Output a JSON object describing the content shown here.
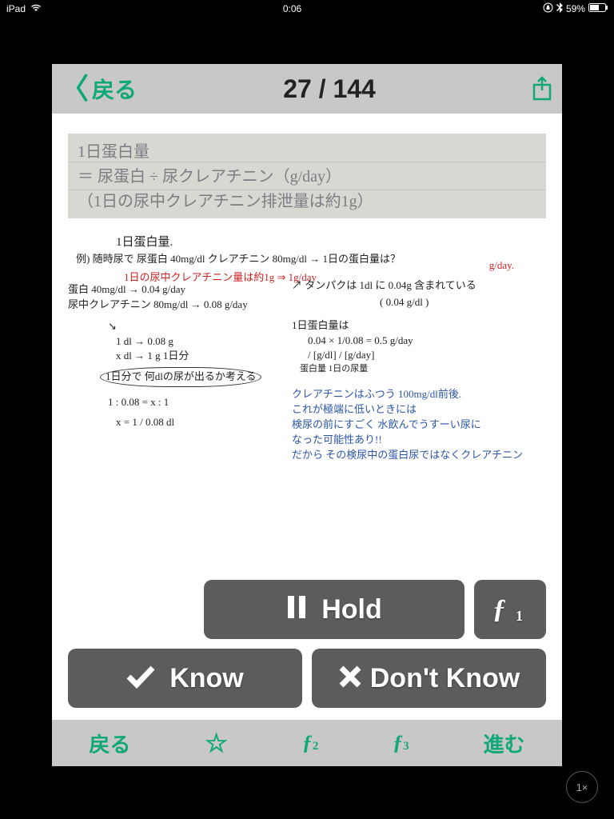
{
  "status_bar": {
    "device": "iPad",
    "time": "0:06",
    "battery_text": "59%"
  },
  "header": {
    "back_label": "戻る",
    "counter": "27 / 144"
  },
  "card": {
    "top_line1": "1日蛋白量",
    "top_line2": "＝ 尿蛋白 ÷ 尿クレアチニン（g/day）",
    "top_line3": "（1日の尿中クレアチニン排泄量は約1g）",
    "title": "1日蛋白量.",
    "example_label": "例)",
    "example": "随時尿で 尿蛋白 40mg/dl クレアチニン 80mg/dl → 1日の蛋白量は？",
    "red1": "1日の尿中クレアチニン量は約1g ⇒ 1g/day",
    "red2": "g/day.",
    "left1": "蛋白  40mg/dl → 0.04 g/day",
    "left2": "尿中クレアチニン 80mg/dl → 0.08 g/day",
    "left3": "1 dl → 0.08 g",
    "left4": "x dl → 1 g      1日分",
    "left5": "1日分で 何dlの尿が出るか考える",
    "left6": "1 : 0.08 = x : 1",
    "left7": "x = 1 / 0.08  dl",
    "right0": "タンパクは 1dl に 0.04g 含まれている",
    "right0b": "( 0.04 g/dl )",
    "right1": "1日蛋白量は",
    "right2": "0.04 × 1/0.08 = 0.5 g/day",
    "right3": "/ [g/dl]   / [g/day]",
    "right4": "蛋白量    1日の尿量",
    "blue1": "クレアチニンはふつう 100mg/dl前後.",
    "blue2": "これが極端に低いときには",
    "blue3": "検尿の前にすごく 水飲んでうすーい尿に",
    "blue4": "なった可能性あり!!",
    "blue5": "だから その検尿中の蛋白尿ではなくクレアチニン"
  },
  "buttons": {
    "hold": "Hold",
    "f1": "ƒ",
    "f1_sub": "1",
    "know": "Know",
    "dont_know": "Don't Know"
  },
  "bottom": {
    "back": "戻る",
    "star": "☆",
    "f2": "ƒ",
    "f2_sub": "2",
    "f3": "ƒ",
    "f3_sub": "3",
    "forward": "進む"
  },
  "zoom": "1×"
}
